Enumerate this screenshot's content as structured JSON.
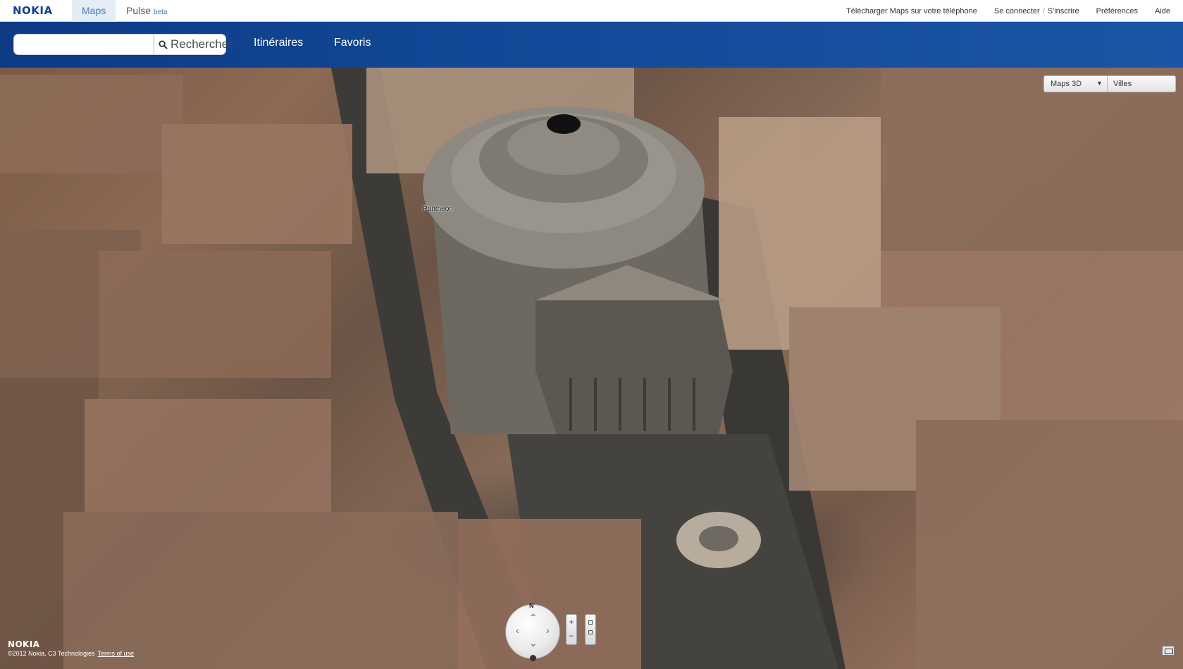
{
  "topbar": {
    "logo": "NOKIA",
    "tabs": [
      {
        "label": "Maps",
        "active": true
      },
      {
        "label": "Pulse",
        "badge": "beta",
        "active": false
      }
    ],
    "links": {
      "download": "Télécharger Maps sur votre téléphone",
      "login": "Se connecter",
      "separator": "/",
      "signup": "S'inscrire",
      "preferences": "Préférences",
      "help": "Aide"
    }
  },
  "navbar": {
    "search": {
      "value": "",
      "placeholder": "",
      "button_label": "Rechercher"
    },
    "links": [
      "Itinéraires",
      "Favoris"
    ]
  },
  "map": {
    "place_label": "Pantheon",
    "view_select": {
      "mode": "Maps 3D",
      "layer": "Villes"
    },
    "compass_north": "N",
    "zoom": {
      "in": "+",
      "out": "−"
    }
  },
  "footer": {
    "logo": "NOKIA",
    "copyright": "©2012 Nokia, C3 Technologies",
    "terms": "Terms of use"
  },
  "colors": {
    "brand_blue": "#124191",
    "nav_blue": "#124a97",
    "active_tab_bg": "#e4ecf6"
  }
}
